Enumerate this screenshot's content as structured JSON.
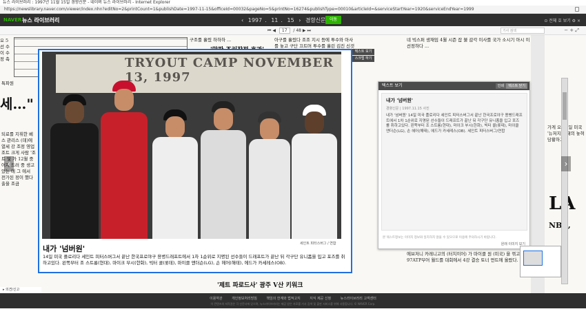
{
  "window": {
    "title": "뉴스 라이브러리 : 1997년 11월 15일 경향신문 - 네이버 뉴스 라이브러리 - Internet Explorer",
    "url": "https://newslibrary.naver.com/viewer/index.nhn?editNo=2&printCount=1&publishDate=1997-11-15&officeId=00032&pageNo=5&printNo=16274&publishType=00010&articleId=&serviceStartYear=1920&serviceEndYear=1999"
  },
  "appbar": {
    "logo": "NAVER",
    "title": "뉴스 라이브러리",
    "year": "1997",
    "month": "11",
    "day": "15",
    "paper": "경향신문",
    "go_label": "이동",
    "right_tools": "⊙ 전체 호 보기  ⚙  ×"
  },
  "pagebar": {
    "first": "⏮",
    "prev": "◀",
    "page_current": "17",
    "page_total": "48",
    "next": "▶",
    "last": "⏭",
    "search_placeholder": "기사 검색",
    "zoom": "−  +  ⤢"
  },
  "newspaper": {
    "top_headline": "'막판 조커작전 효과'",
    "left_headline": "세…\"",
    "caption_title": "내가 '넘버원'",
    "caption_credit": "세인트 피터스버그 / 연합",
    "caption_body": "14일 미국 플로리다 세인트 피터스버그서 끝난 한국프로야구 용병드래프트에서 1차 1순위로 지명된 선수들이 드래프트가 끝난 뒤 각구단 유니폼을 입고 포즈를 취하고있다. 왼쪽부터 조 스트롱(현대), 마이크 부시(한화), 빅터 콜(롯데), 마이클 앤더슨(LG), 손 헤어(해태), 에드가 카세레스(OB).",
    "banner_text": "TRYOUT CAMP NOVEMBER 13, 1997",
    "right_headline": "LA",
    "right_sub": "NBA,",
    "col_right_small": "가게 오",
    "bottom_headline": "'제트 파로드사' 광주 V산 키워크"
  },
  "side_buttons": {
    "text_view": "텍스트 보기",
    "scrap": "스크랩 하기"
  },
  "text_panel": {
    "title": "텍스트 보기",
    "btn_print": "인쇄",
    "btn_share": "텍스트 닫기",
    "article_title": "내가 '넘버원'",
    "article_meta": "경향신문 | 1997.11.15 사진",
    "article_body": "내가 '넘버원' 14일 미국 플로리다 세인트 피터스버그서 끝난 한국프로야구 용병드래프트에서 1차 1순위로 지명된 선수들이 드래프트가 끝난 뒤 각구단 유니폼을 입고 포즈를 취하고있다. 왼쪽부터 조 스트롱(현대), 마이크 부시(한화), 빅터 콜(롯데), 마이클 앤더슨(LG), 손 헤어(해태), 에드가 카세레스(OB). 세인트 피터스버그/연합",
    "footer": "본 텍스트정보는 이미지 정보와 일치하지 않을 수 있으므로 이용에 주의하시기 바랍니다.",
    "footer2": "원래 이미지 보기"
  },
  "statusbar": {
    "label": "▸ 의견/신고"
  },
  "footer": {
    "links": [
      "이용약관",
      "개인정보처리방침",
      "책임의 한계와 법적고지",
      "지식 제공 신청",
      "뉴스라이브러리 고객센터"
    ],
    "copyright": "이 컨텐츠의 저작권은 각 신문사에 있으며, 뉴스라이브러리는 제공 받은 자료를 기사 검색 및 출판 서비스를 위해 사용합니다. © NAVER Corp."
  }
}
